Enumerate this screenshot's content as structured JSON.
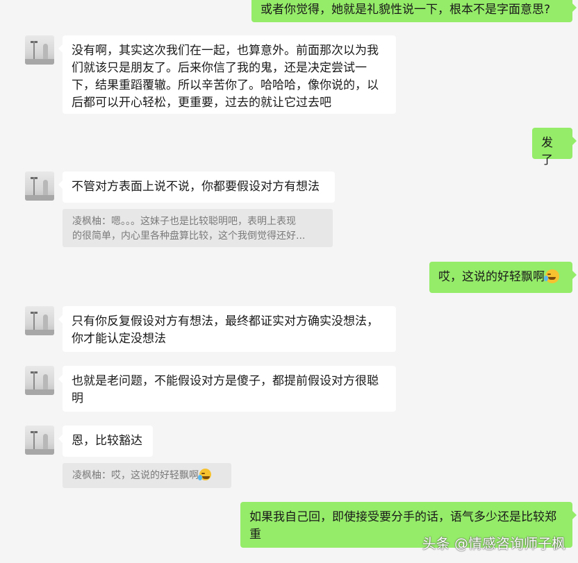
{
  "chat": {
    "messages": [
      {
        "side": "out",
        "text": "或者你觉得，她就是礼貌性说一下，根本不是字面意思?"
      },
      {
        "side": "in",
        "text": "没有啊，其实这次我们在一起，也算意外。前面那次以为我们就该只是朋友了。后来你信了我的鬼，还是决定尝试一下，结果重蹈覆辙。所以辛苦你了。哈哈哈，像你说的，以后都可以开心轻松，更重要，过去的就让它过去吧"
      },
      {
        "side": "out",
        "text": "发了"
      },
      {
        "side": "in",
        "text": "不管对方表面上说不说，你都要假设对方有想法"
      },
      {
        "side": "quote",
        "line1": "凌枫柚：嗯。。。这妹子也是比较聪明吧，表明上表现",
        "line2": "的很简单，内心里各种盘算比较，这个我倒觉得还好..."
      },
      {
        "side": "out",
        "text": "哎，这说的好轻飘啊",
        "emoji": "laugh-cry-emoji"
      },
      {
        "side": "in",
        "text": "只有你反复假设对方有想法，最终都证实对方确实没想法，你才能认定没想法"
      },
      {
        "side": "in",
        "text": "也就是老问题，不能假设对方是傻子，都提前假设对方很聪明"
      },
      {
        "side": "in",
        "text": "恩，比较豁达"
      },
      {
        "side": "quote",
        "line1": "凌枫柚：哎，这说的好轻飘啊",
        "emoji": "laugh-cry-emoji"
      },
      {
        "side": "out",
        "text": "如果我自己回，即使接受要分手的话，语气多少还是比较郑重"
      }
    ]
  },
  "watermark": "头条 @情感咨询师子枫",
  "colors": {
    "background": "#f5f5f5",
    "incoming_bubble": "#ffffff",
    "outgoing_bubble": "#95ec69",
    "quote_bg": "#e7e7e7"
  }
}
